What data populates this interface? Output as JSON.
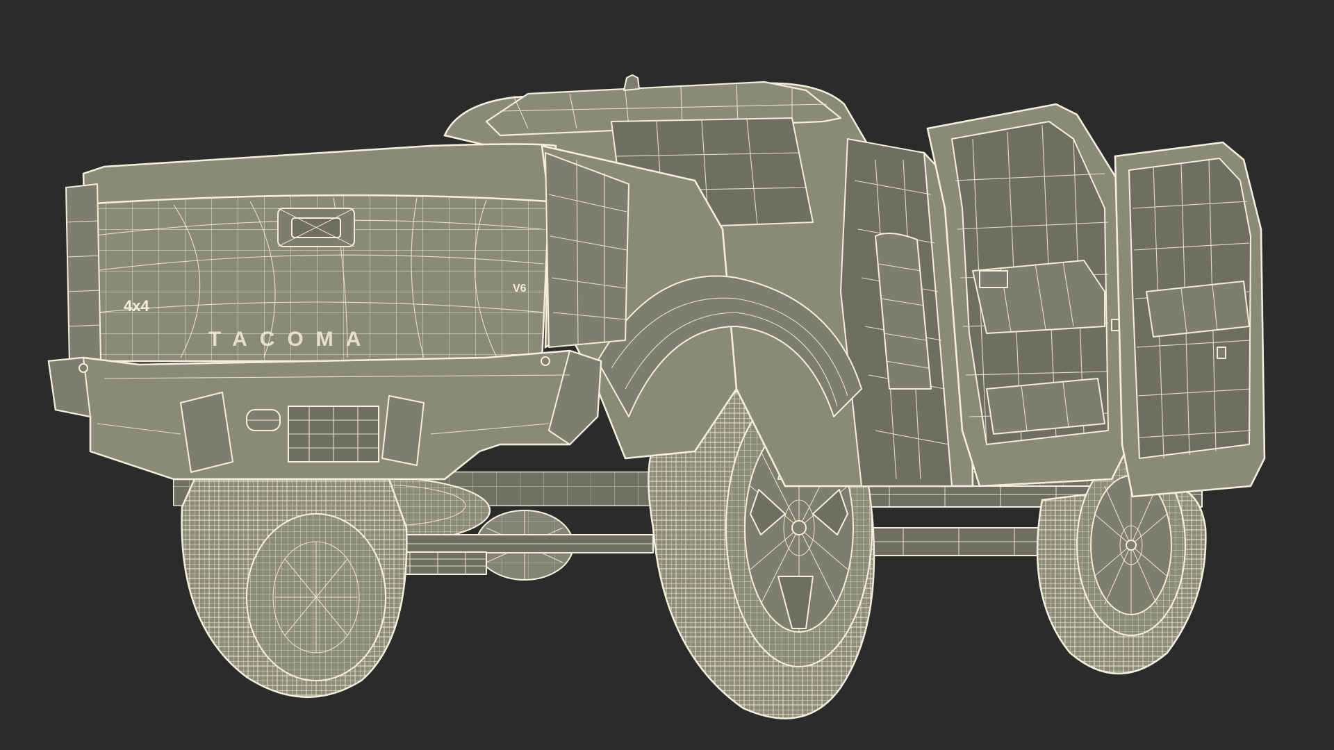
{
  "scene": {
    "subject": "pickup-truck-wireframe",
    "background_color": "#2b2b2b",
    "surface_color": "#8a8a79",
    "wire_color": "#f2f0dc"
  },
  "badges": {
    "drive": "4x4",
    "engine": "V6",
    "tailgate": "TACOMA"
  }
}
